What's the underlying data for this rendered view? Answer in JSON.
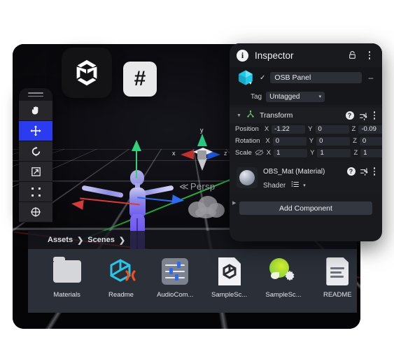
{
  "app": {
    "tiles": [
      {
        "name": "unity-logo-tile",
        "icon": "unity-icon"
      },
      {
        "name": "csharp-tile",
        "icon": "hash-icon",
        "glyph": "#"
      }
    ]
  },
  "viewport": {
    "gizmo": {
      "x_label": "x",
      "y_label": "y",
      "z_label": "z"
    },
    "camera_mode": "Persp",
    "camera_chevron": "≪",
    "axis_colors": {
      "x": "#c0302c",
      "y": "#25c97f",
      "z": "#1f55d8"
    },
    "object": "humanoid-model"
  },
  "toolbar": {
    "tools": [
      {
        "name": "hand-tool",
        "icon": "hand-icon",
        "selected": false
      },
      {
        "name": "move-tool",
        "icon": "move-icon",
        "selected": true
      },
      {
        "name": "rotate-tool",
        "icon": "rotate-icon",
        "selected": false
      },
      {
        "name": "scale-tool",
        "icon": "scale-icon",
        "selected": false
      },
      {
        "name": "rect-tool",
        "icon": "rect-transform-icon",
        "selected": false
      },
      {
        "name": "transform-tool",
        "icon": "transform-icon",
        "selected": false
      }
    ],
    "selected_color": "#2a3bf0"
  },
  "assets": {
    "breadcrumb": [
      {
        "label": "Assets",
        "sep": "❯"
      },
      {
        "label": "Scenes",
        "sep": "❯"
      }
    ],
    "items": [
      {
        "label": "Materials",
        "icon": "folder-icon"
      },
      {
        "label": "Readme",
        "icon": "unity-prefab-icon"
      },
      {
        "label": "AudioCom...",
        "icon": "audio-mixer-icon"
      },
      {
        "label": "SampleSc...",
        "icon": "unity-scene-icon"
      },
      {
        "label": "SampleSc...",
        "icon": "lighting-settings-icon"
      },
      {
        "label": "README",
        "icon": "text-document-icon"
      }
    ]
  },
  "inspector": {
    "title": "Inspector",
    "info_glyph": "i",
    "lock_icon": "lock-icon",
    "menu_icon": "kebab-menu-icon",
    "object": {
      "enabled_check": "✓",
      "name": "OSB Panel",
      "minus": "–",
      "tag_label": "Tag",
      "tag_value": "Untagged",
      "caret": "▾"
    },
    "transform": {
      "title": "Transform",
      "help_glyph": "?",
      "rows": [
        {
          "label": "Position",
          "x_axis": "X",
          "x": "-1.22",
          "y_axis": "Y",
          "y": "0",
          "z_axis": "Z",
          "z": "-0.09"
        },
        {
          "label": "Rotation",
          "x_axis": "X",
          "x": "0",
          "y_axis": "Y",
          "y": "0",
          "z_axis": "Z",
          "z": "0"
        },
        {
          "label": "Scale",
          "x_axis": "X",
          "x": "1",
          "y_axis": "Y",
          "y": "1",
          "z_axis": "Z",
          "z": "1"
        }
      ]
    },
    "material": {
      "title": "OBS_Mat (Material)",
      "help_glyph": "?",
      "shader_label": "Shader",
      "caret": "▾"
    },
    "add_component": "Add Component"
  }
}
